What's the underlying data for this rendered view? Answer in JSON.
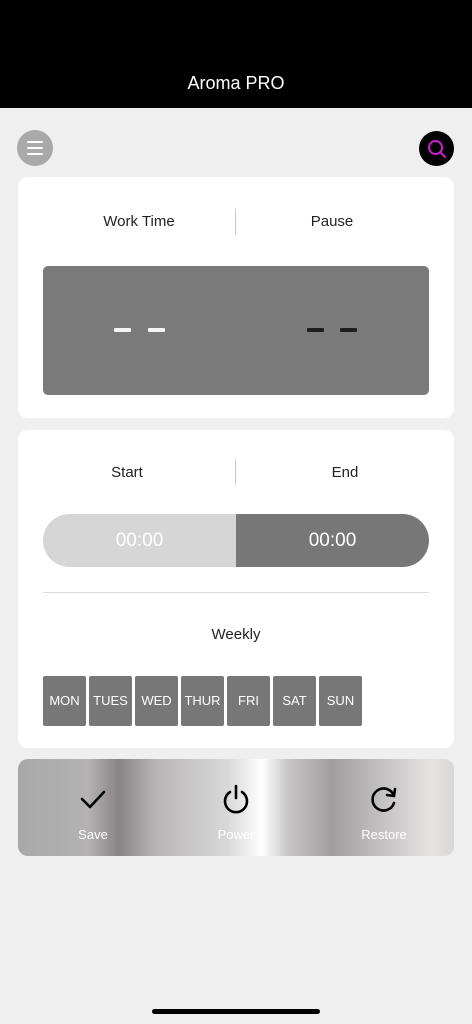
{
  "header": {
    "title": "Aroma PRO"
  },
  "icons": {
    "menu": "hamburger-menu-icon",
    "search": "search-icon",
    "accent": "#d020d0"
  },
  "timer_card": {
    "work_label": "Work Time",
    "pause_label": "Pause",
    "work_value": "- -",
    "pause_value": "- -"
  },
  "schedule_card": {
    "start_label": "Start",
    "end_label": "End",
    "start_time": "00:00",
    "end_time": "00:00",
    "weekly_label": "Weekly",
    "days": [
      "MON",
      "TUES",
      "WED",
      "THUR",
      "FRI",
      "SAT",
      "SUN"
    ]
  },
  "actions": {
    "save": "Save",
    "power": "Power",
    "restore": "Restore"
  }
}
